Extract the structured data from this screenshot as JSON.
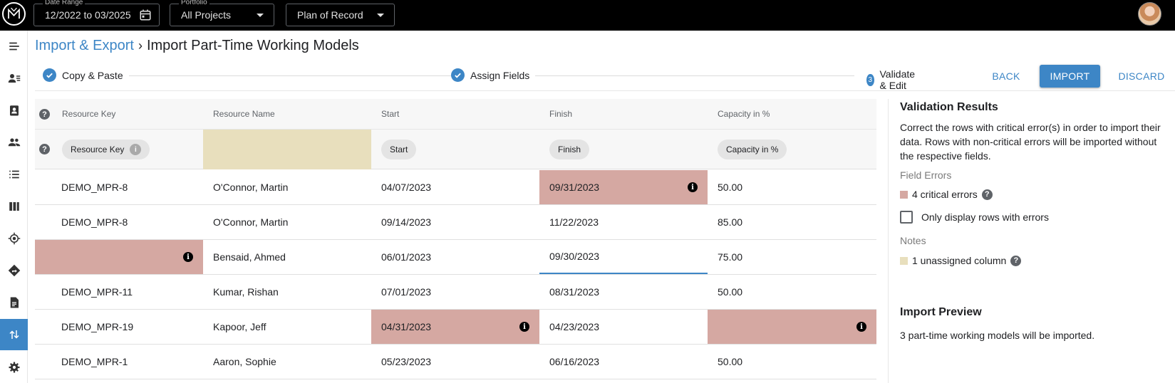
{
  "topbar": {
    "date_range": {
      "label": "Date Range",
      "value": "12/2022 to 03/2025"
    },
    "portfolio": {
      "label": "Portfolio",
      "value": "All Projects"
    },
    "plan": {
      "value": "Plan of Record"
    }
  },
  "sidebar": {
    "items": [
      {
        "icon": "collapse-menu-icon"
      },
      {
        "icon": "resource-list-icon"
      },
      {
        "icon": "badge-icon"
      },
      {
        "icon": "team-icon"
      },
      {
        "icon": "list-icon"
      },
      {
        "icon": "columns-icon"
      },
      {
        "icon": "target-icon"
      },
      {
        "icon": "directions-icon"
      },
      {
        "icon": "document-icon"
      },
      {
        "icon": "import-export-icon",
        "active": true
      },
      {
        "icon": "settings-icon"
      }
    ]
  },
  "breadcrumb": {
    "parent": "Import & Export",
    "separator": "›",
    "current": "Import Part-Time Working Models"
  },
  "stepper": {
    "steps": [
      {
        "label": "Copy & Paste",
        "state": "done"
      },
      {
        "label": "Assign Fields",
        "state": "done"
      },
      {
        "label": "Validate & Edit",
        "state": "current",
        "number": "3"
      }
    ],
    "back_label": "BACK",
    "import_label": "IMPORT",
    "discard_label": "DISCARD"
  },
  "table": {
    "help_glyph": "?",
    "headers": [
      "Resource Key",
      "Resource Name",
      "Start",
      "Finish",
      "Capacity in %"
    ],
    "mapping": [
      "Resource Key",
      "",
      "Start",
      "Finish",
      "Capacity in %"
    ],
    "mapping_info_glyph": "i",
    "error_info_glyph": "i",
    "rows": [
      {
        "cells": [
          "DEMO_MPR-8",
          "O'Connor, Martin",
          "04/07/2023",
          "09/31/2023",
          "50.00"
        ],
        "errors": [
          3
        ]
      },
      {
        "cells": [
          "DEMO_MPR-8",
          "O'Connor, Martin",
          "09/14/2023",
          "11/22/2023",
          "85.00"
        ],
        "errors": []
      },
      {
        "cells": [
          "",
          "Bensaid, Ahmed",
          "06/01/2023",
          "09/30/2023",
          "75.00"
        ],
        "errors": [
          0
        ],
        "editing": 3
      },
      {
        "cells": [
          "DEMO_MPR-11",
          "Kumar, Rishan",
          "07/01/2023",
          "08/31/2023",
          "50.00"
        ],
        "errors": []
      },
      {
        "cells": [
          "DEMO_MPR-19",
          "Kapoor, Jeff",
          "04/31/2023",
          "04/23/2023",
          ""
        ],
        "errors": [
          2,
          4
        ]
      },
      {
        "cells": [
          "DEMO_MPR-1",
          "Aaron, Sophie",
          "05/23/2023",
          "06/16/2023",
          "50.00"
        ],
        "errors": []
      }
    ]
  },
  "panel": {
    "validation_title": "Validation Results",
    "validation_text": "Correct the rows with critical error(s) in order to import their data. Rows with non-critical errors will be imported without the respective fields.",
    "field_errors_label": "Field Errors",
    "critical_errors": "4 critical errors",
    "only_errors_label": "Only display rows with errors",
    "notes_label": "Notes",
    "unassigned_label": "1 unassigned column",
    "preview_title": "Import Preview",
    "preview_text": "3 part-time working models will be imported."
  },
  "colors": {
    "accent": "#3d86c6",
    "error": "#d5a8a2",
    "unassigned": "#e8dfbd"
  }
}
